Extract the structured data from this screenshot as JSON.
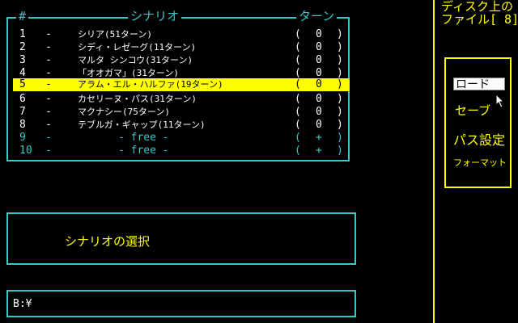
{
  "scenario_table": {
    "header_num": "#",
    "header_name": "シナリオ",
    "header_turns": "ターン",
    "rows": [
      {
        "num": "1",
        "dash": "-",
        "name": "シリア(51ターン)",
        "lp": "(",
        "val": "0",
        "rp": ")"
      },
      {
        "num": "2",
        "dash": "-",
        "name": "シディ・レゼーグ(11ターン)",
        "lp": "(",
        "val": "0",
        "rp": ")"
      },
      {
        "num": "3",
        "dash": "-",
        "name": "マルタ シンコウ(31ターン)",
        "lp": "(",
        "val": "0",
        "rp": ")"
      },
      {
        "num": "4",
        "dash": "-",
        "name": "「オオガマ」(31ターン)",
        "lp": "(",
        "val": "0",
        "rp": ")"
      },
      {
        "num": "5",
        "dash": "-",
        "name": "アラム・エル・ハルファ(19ターン)",
        "lp": "(",
        "val": "0",
        "rp": ")"
      },
      {
        "num": "6",
        "dash": "-",
        "name": "カセリーヌ・パス(31ターン)",
        "lp": "(",
        "val": "0",
        "rp": ")"
      },
      {
        "num": "7",
        "dash": "-",
        "name": "マクナシー(75ターン)",
        "lp": "(",
        "val": "0",
        "rp": ")"
      },
      {
        "num": "8",
        "dash": "-",
        "name": "テブルガ・ギャップ(11ターン)",
        "lp": "(",
        "val": "0",
        "rp": ")"
      },
      {
        "num": "9",
        "dash": "-",
        "name": "-  free  -",
        "lp": "(",
        "val": "+",
        "rp": ")"
      },
      {
        "num": "10",
        "dash": "-",
        "name": "-  free  -",
        "lp": "(",
        "val": "+",
        "rp": ")"
      }
    ]
  },
  "message": "シナリオの選択",
  "path": "B:¥",
  "disk": {
    "title_line1": "ディスク上の",
    "title_line2": "ファイル[ 8]"
  },
  "menu": {
    "load": "ロード",
    "save": "セーブ",
    "password": "パス設定",
    "format": "フォーマット"
  },
  "colors": {
    "cyan": "#33c9c9",
    "yellow": "#ffff00",
    "background": "#000000"
  }
}
